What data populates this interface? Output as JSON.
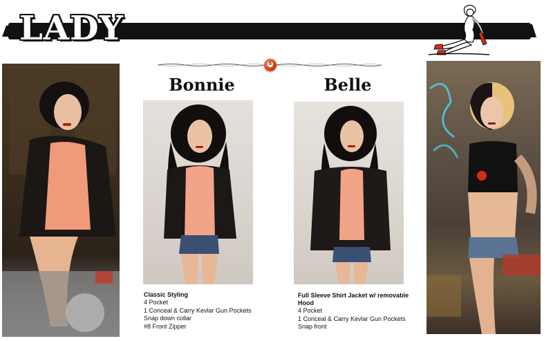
{
  "header": {
    "brand": "LADY"
  },
  "divider": {
    "ball_number": "5"
  },
  "colors": {
    "accent": "#e2420f",
    "bar": "#111111"
  },
  "products": [
    {
      "name": "Bonnie",
      "heading": "Classic Styling",
      "features": [
        "4 Pocket",
        "1 Conceal & Carry Kevlar Gun Pockets",
        "Snap down collar",
        "#8 Front Zipper"
      ]
    },
    {
      "name": "Belle",
      "heading": "Full Sleeve Shirt Jacket w/ removable Hood",
      "features": [
        "4 Pocket",
        "1 Conceal & Carry Kevlar Gun Pockets",
        "Snap front"
      ]
    }
  ]
}
